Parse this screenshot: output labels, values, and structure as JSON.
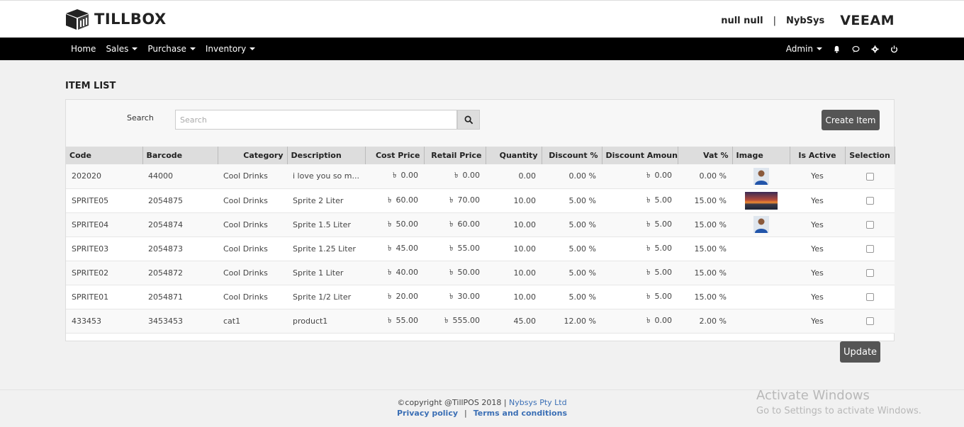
{
  "brand": {
    "name": "TILLBOX"
  },
  "header": {
    "user": "null null",
    "company": "NybSys",
    "partner_logo": "VEEAM"
  },
  "nav": {
    "items": [
      {
        "label": "Home",
        "dropdown": false
      },
      {
        "label": "Sales",
        "dropdown": true
      },
      {
        "label": "Purchase",
        "dropdown": true
      },
      {
        "label": "Inventory",
        "dropdown": true
      }
    ],
    "admin_label": "Admin",
    "icons": [
      "bell-icon",
      "chat-icon",
      "gear-icon",
      "power-icon"
    ]
  },
  "page": {
    "title": "ITEM LIST"
  },
  "search": {
    "label": "Search",
    "placeholder": "Search"
  },
  "buttons": {
    "create": "Create Item",
    "update": "Update"
  },
  "currency_symbol": "৳",
  "table": {
    "columns": [
      "Code",
      "Barcode",
      "Category",
      "Description",
      "Cost Price",
      "Retail Price",
      "Quantity",
      "Discount %",
      "Discount Amount",
      "Vat %",
      "Image",
      "Is Active",
      "Selection"
    ],
    "rows": [
      {
        "code": "202020",
        "barcode": "44000",
        "category": "Cool Drinks",
        "description": "i love you so m...",
        "cost": "0.00",
        "retail": "0.00",
        "qty": "0.00",
        "disc_pct": "0.00 %",
        "disc_amt": "0.00",
        "vat": "0.00 %",
        "image": "person",
        "active": "Yes"
      },
      {
        "code": "SPRITE05",
        "barcode": "2054875",
        "category": "Cool Drinks",
        "description": "Sprite 2 Liter",
        "cost": "60.00",
        "retail": "70.00",
        "qty": "10.00",
        "disc_pct": "5.00 %",
        "disc_amt": "5.00",
        "vat": "15.00 %",
        "image": "sunset",
        "active": "Yes"
      },
      {
        "code": "SPRITE04",
        "barcode": "2054874",
        "category": "Cool Drinks",
        "description": "Sprite 1.5 Liter",
        "cost": "50.00",
        "retail": "60.00",
        "qty": "10.00",
        "disc_pct": "5.00 %",
        "disc_amt": "5.00",
        "vat": "15.00 %",
        "image": "person",
        "active": "Yes"
      },
      {
        "code": "SPRITE03",
        "barcode": "2054873",
        "category": "Cool Drinks",
        "description": "Sprite 1.25 Liter",
        "cost": "45.00",
        "retail": "55.00",
        "qty": "10.00",
        "disc_pct": "5.00 %",
        "disc_amt": "5.00",
        "vat": "15.00 %",
        "image": "",
        "active": "Yes"
      },
      {
        "code": "SPRITE02",
        "barcode": "2054872",
        "category": "Cool Drinks",
        "description": "Sprite 1 Liter",
        "cost": "40.00",
        "retail": "50.00",
        "qty": "10.00",
        "disc_pct": "5.00 %",
        "disc_amt": "5.00",
        "vat": "15.00 %",
        "image": "",
        "active": "Yes"
      },
      {
        "code": "SPRITE01",
        "barcode": "2054871",
        "category": "Cool Drinks",
        "description": "Sprite 1/2 Liter",
        "cost": "20.00",
        "retail": "30.00",
        "qty": "10.00",
        "disc_pct": "5.00 %",
        "disc_amt": "5.00",
        "vat": "15.00 %",
        "image": "",
        "active": "Yes"
      },
      {
        "code": "433453",
        "barcode": "3453453",
        "category": "cat1",
        "description": "product1",
        "cost": "55.00",
        "retail": "555.00",
        "qty": "45.00",
        "disc_pct": "12.00 %",
        "disc_amt": "0.00",
        "vat": "2.00 %",
        "image": "",
        "active": "Yes"
      }
    ]
  },
  "footer": {
    "copyright": "©copyright @TillPOS 2018 |",
    "company_link": "Nybsys Pty Ltd",
    "privacy": "Privacy policy",
    "separator": "|",
    "terms": "Terms and conditions"
  },
  "watermark": {
    "line1": "Activate Windows",
    "line2": "Go to Settings to activate Windows."
  }
}
